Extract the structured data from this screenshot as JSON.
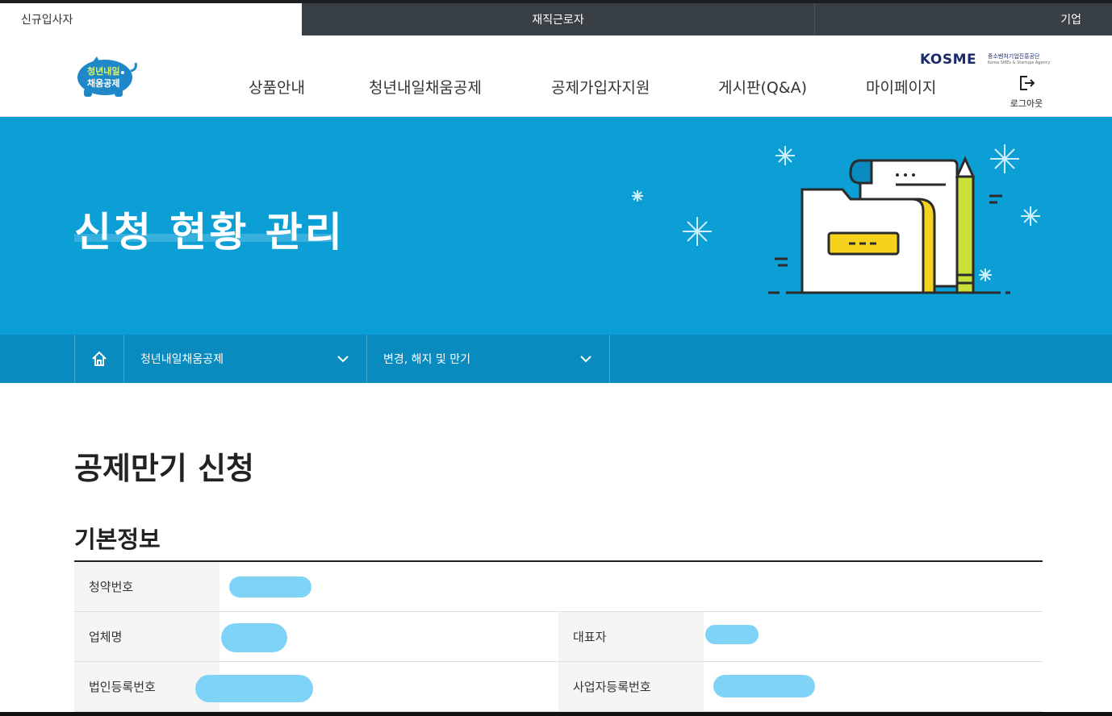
{
  "topbar": {
    "tab_new": "신규입사자",
    "tab_current": "재직근로자",
    "tab_company": "기업"
  },
  "header": {
    "logo_line1": "청년내일",
    "logo_line2": "채움공제",
    "nav": [
      "상품안내",
      "청년내일채움공제",
      "공제가입자지원",
      "게시판(Q&A)",
      "마이페이지"
    ],
    "kosme_brand": "KOSME",
    "kosme_sub": "중소벤처기업진흥공단",
    "kosme_sub2": "Korea SMEs & Startups Agency",
    "logout_label": "로그아웃"
  },
  "banner": {
    "title": "신청 현황 관리"
  },
  "breadcrumb": {
    "level1": "청년내일채움공제",
    "level2": "변경, 해지 및 만기"
  },
  "main": {
    "page_title": "공제만기 신청",
    "section_title": "기본정보",
    "labels": {
      "contract_no": "청약번호",
      "company_name": "업체명",
      "representative": "대표자",
      "corp_reg_no": "법인등록번호",
      "biz_reg_no": "사업자등록번호"
    }
  },
  "colors": {
    "banner_bg": "#0b9fd6",
    "breadbar_bg": "#0a8bbf",
    "topbar_bg": "#394045",
    "redaction": "#7fd3f7",
    "folder_yellow": "#f5d31c"
  }
}
